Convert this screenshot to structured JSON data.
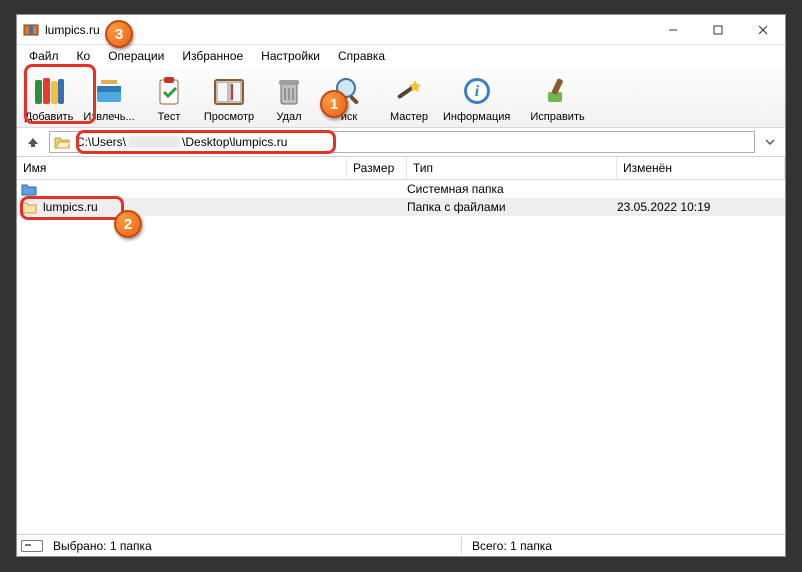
{
  "window": {
    "title": "lumpics.ru"
  },
  "menubar": {
    "file": "Файл",
    "commands": "Ко",
    "operations": "Операции",
    "favorites": "Избранное",
    "settings": "Настройки",
    "help": "Справка"
  },
  "toolbar": {
    "add": "Добавить",
    "extract": "Извлечь...",
    "test": "Тест",
    "view": "Просмотр",
    "delete": "Удал",
    "find": "иск",
    "wizard": "Мастер",
    "info": "Информация",
    "repair": "Исправить"
  },
  "path": {
    "prefix": "C:\\Users\\",
    "suffix": "\\Desktop\\lumpics.ru"
  },
  "columns": {
    "name": "Имя",
    "size": "Размер",
    "type": "Тип",
    "modified": "Изменён"
  },
  "rows": {
    "parent": {
      "type": "Cистемная папка"
    },
    "item": {
      "name": "lumpics.ru",
      "type": "Папка с файлами",
      "modified": "23.05.2022 10:19"
    }
  },
  "status": {
    "selected": "Выбрано: 1 папка",
    "total": "Всего: 1 папка"
  },
  "badges": {
    "b1": "1",
    "b2": "2",
    "b3": "3"
  }
}
